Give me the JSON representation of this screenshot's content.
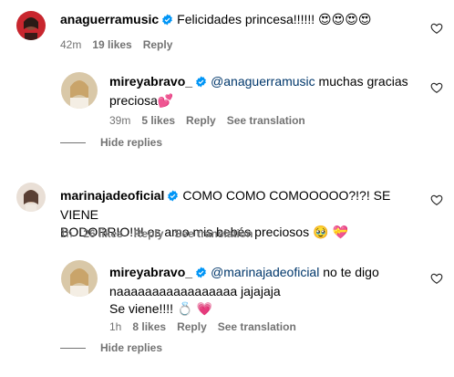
{
  "comments": [
    {
      "username": "anaguerramusic",
      "text": "Felicidades princesa!!!!!! ",
      "emojis": "😍😍😍😍",
      "time": "42m",
      "likes": "19 likes",
      "reply": "Reply",
      "replies": [
        {
          "username": "mireyabravo_",
          "mention": "@anaguerramusic",
          "text_line1": " muchas gracias",
          "text_line2": "preciosa",
          "emoji_line2": "💕",
          "time": "39m",
          "likes": "5 likes",
          "reply": "Reply",
          "translate": "See translation"
        }
      ],
      "hide_replies": "Hide replies"
    },
    {
      "username": "marinajadeoficial",
      "text_line1": "COMO COMO COMOOOOO?!?! SE VIENE",
      "text_line2": "BODORRIO!!!! os amo mis bebés preciosos",
      "emoji_line2": "🥹 💝",
      "time": "1h",
      "likes": "26 likes",
      "reply": "Reply",
      "translate": "See translation",
      "replies": [
        {
          "username": "mireyabravo_",
          "mention": "@marinajadeoficial",
          "text_line1": " no te digo",
          "text_line2": "naaaaaaaaaaaaaaaaa jajajaja",
          "text_line3": "Se viene!!!! ",
          "emoji_line3": "💍 💗",
          "time": "1h",
          "likes": "8 likes",
          "reply": "Reply",
          "translate": "See translation"
        }
      ],
      "hide_replies": "Hide replies"
    }
  ],
  "icons": {
    "heart": "heart-outline-icon",
    "verified": "verified-badge-icon"
  },
  "colors": {
    "verified": "#0095f6",
    "mention": "#00376b",
    "secondary_text": "#737373"
  }
}
